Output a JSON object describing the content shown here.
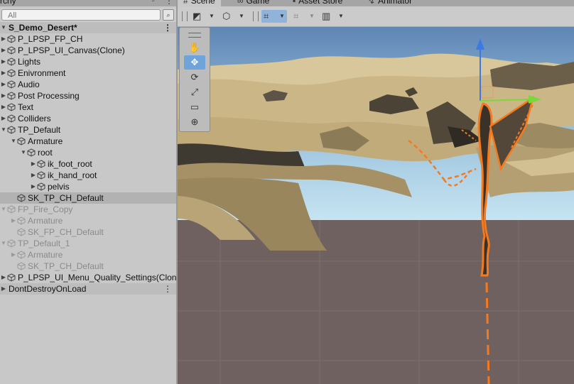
{
  "hierarchy": {
    "tab_title": "rchy",
    "search": {
      "placeholder": "All",
      "value": ""
    },
    "scene_name": "S_Demo_Desert*",
    "items": [
      {
        "label": "P_LPSP_FP_CH",
        "depth": 0,
        "fold": "right",
        "state": "normal"
      },
      {
        "label": "P_LPSP_UI_Canvas(Clone)",
        "depth": 0,
        "fold": "right",
        "state": "normal"
      },
      {
        "label": "Lights",
        "depth": 0,
        "fold": "right",
        "state": "normal"
      },
      {
        "label": "Enivronment",
        "depth": 0,
        "fold": "right",
        "state": "normal"
      },
      {
        "label": "Audio",
        "depth": 0,
        "fold": "right",
        "state": "normal"
      },
      {
        "label": "Post Processing",
        "depth": 0,
        "fold": "right",
        "state": "normal"
      },
      {
        "label": "Text",
        "depth": 0,
        "fold": "right",
        "state": "normal"
      },
      {
        "label": "Colliders",
        "depth": 0,
        "fold": "right",
        "state": "normal"
      },
      {
        "label": "TP_Default",
        "depth": 0,
        "fold": "down",
        "state": "normal"
      },
      {
        "label": "Armature",
        "depth": 1,
        "fold": "down",
        "state": "normal"
      },
      {
        "label": "root",
        "depth": 2,
        "fold": "down",
        "state": "normal"
      },
      {
        "label": "ik_foot_root",
        "depth": 3,
        "fold": "right",
        "state": "normal"
      },
      {
        "label": "ik_hand_root",
        "depth": 3,
        "fold": "right",
        "state": "normal"
      },
      {
        "label": "pelvis",
        "depth": 3,
        "fold": "right",
        "state": "normal"
      },
      {
        "label": "SK_TP_CH_Default",
        "depth": 1,
        "fold": "none",
        "state": "selected"
      },
      {
        "label": "FP_Fire_Copy",
        "depth": 0,
        "fold": "down",
        "state": "dim"
      },
      {
        "label": "Armature",
        "depth": 1,
        "fold": "right",
        "state": "dim"
      },
      {
        "label": "SK_FP_CH_Default",
        "depth": 1,
        "fold": "none",
        "state": "dim"
      },
      {
        "label": "TP_Default_1",
        "depth": 0,
        "fold": "down",
        "state": "dim"
      },
      {
        "label": "Armature",
        "depth": 1,
        "fold": "right",
        "state": "dim"
      },
      {
        "label": "SK_TP_CH_Default",
        "depth": 1,
        "fold": "none",
        "state": "dim"
      },
      {
        "label": "P_LPSP_UI_Menu_Quality_Settings(Clon",
        "depth": 0,
        "fold": "right",
        "state": "normal"
      }
    ],
    "dont_destroy_label": "DontDestroyOnLoad",
    "more_glyph": "⋮"
  },
  "scene_tabs": [
    {
      "label": "Scene",
      "icon": "hash-icon",
      "active": true
    },
    {
      "label": "Game",
      "icon": "gamepad-icon",
      "active": false
    },
    {
      "label": "Asset Store",
      "icon": "store-icon",
      "active": false
    },
    {
      "label": "Animator",
      "icon": "animator-icon",
      "active": false
    }
  ],
  "toolbar": {
    "buttons": [
      {
        "name": "draw-mode",
        "icon": "draw-mode-icon",
        "active": false
      },
      {
        "name": "render-mode",
        "icon": "cube-icon",
        "active": false
      },
      {
        "name": "grid-snap",
        "icon": "grid-icon",
        "active": true
      },
      {
        "name": "increment-snap",
        "icon": "snap-icon",
        "active": false
      },
      {
        "name": "gizmos",
        "icon": "gizmo-icon",
        "active": false
      }
    ]
  },
  "tools": [
    {
      "name": "view-tool",
      "icon": "hand-icon",
      "glyph": "✋",
      "active": false
    },
    {
      "name": "move-tool",
      "icon": "move-icon",
      "glyph": "✥",
      "active": true
    },
    {
      "name": "rotate-tool",
      "icon": "rotate-icon",
      "glyph": "⟳",
      "active": false
    },
    {
      "name": "scale-tool",
      "icon": "scale-icon",
      "glyph": "⤢",
      "active": false
    },
    {
      "name": "rect-tool",
      "icon": "rect-icon",
      "glyph": "▭",
      "active": false
    },
    {
      "name": "transform-tool",
      "icon": "transform-icon",
      "glyph": "⊕",
      "active": false
    }
  ],
  "colors": {
    "sky_top": "#5f86b4",
    "sky_bottom": "#b9dcec",
    "ground": "#6e6160",
    "sand": "#c8b383",
    "sand_shadow": "#8c7b57",
    "dark_rock": "#3f3a31",
    "selection_orange": "#f47a1f",
    "gizmo_blue": "#3c78e6",
    "gizmo_green": "#7ad83a",
    "active_blue": "#6fa3db"
  }
}
